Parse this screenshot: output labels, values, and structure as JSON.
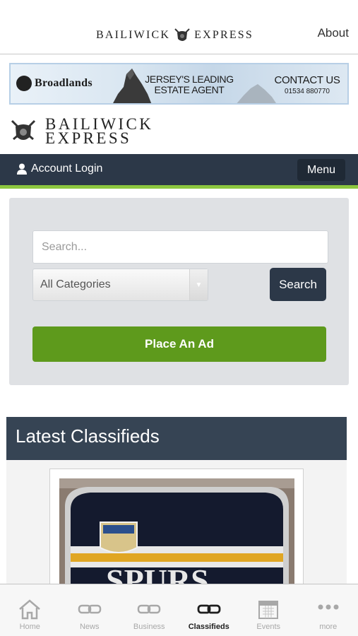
{
  "topbar": {
    "brand_left": "BAILIWICK",
    "brand_right": "EXPRESS",
    "about": "About"
  },
  "ad": {
    "advertiser": "Broadlands",
    "tagline_line1": "JERSEY'S LEADING",
    "tagline_line2": "ESTATE AGENT",
    "contact": "CONTACT US",
    "phone": "01534 880770"
  },
  "site_logo": {
    "line1": "BAILIWICK",
    "line2": "EXPRESS"
  },
  "account": {
    "login_label": "Account Login",
    "menu_label": "Menu"
  },
  "search": {
    "placeholder": "Search...",
    "category_selected": "All Categories",
    "button_label": "Search",
    "place_ad_label": "Place An Ad"
  },
  "latest": {
    "heading": "Latest Classifieds",
    "first_item_photo_text": "SPURS"
  },
  "tabs": [
    {
      "label": "Home",
      "icon": "home-icon",
      "active": false
    },
    {
      "label": "News",
      "icon": "link-icon",
      "active": false
    },
    {
      "label": "Business",
      "icon": "link-icon",
      "active": false
    },
    {
      "label": "Classifieds",
      "icon": "link-icon",
      "active": true
    },
    {
      "label": "Events",
      "icon": "calendar-icon",
      "active": false
    },
    {
      "label": "more",
      "icon": "more-dots-icon",
      "active": false
    }
  ],
  "colors": {
    "navy": "#2c3848",
    "green": "#5e9a1c",
    "accent_line": "#8cc63f"
  }
}
